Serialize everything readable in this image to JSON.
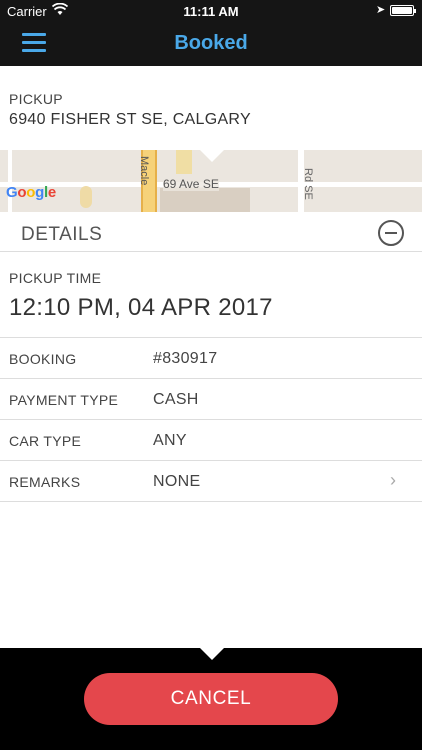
{
  "status_bar": {
    "carrier": "Carrier",
    "time": "11:11 AM"
  },
  "nav": {
    "title": "Booked",
    "accent_color": "#4aa8e8"
  },
  "pickup": {
    "label": "PICKUP",
    "address": "6940 FISHER ST SE, CALGARY"
  },
  "map": {
    "labels": {
      "macleod": "Macle",
      "street": "69 Ave SE",
      "road": "Rd SE"
    },
    "provider": "Google"
  },
  "details": {
    "title": "DETAILS"
  },
  "pickup_time": {
    "label": "PICKUP TIME",
    "value": "12:10 PM, 04 APR 2017"
  },
  "rows": [
    {
      "key": "BOOKING",
      "value": "#830917"
    },
    {
      "key": "PAYMENT TYPE",
      "value": "CASH"
    },
    {
      "key": "CAR TYPE",
      "value": "ANY"
    },
    {
      "key": "REMARKS",
      "value": "NONE"
    }
  ],
  "footer": {
    "cancel_label": "CANCEL",
    "cancel_color": "#e4474c"
  }
}
